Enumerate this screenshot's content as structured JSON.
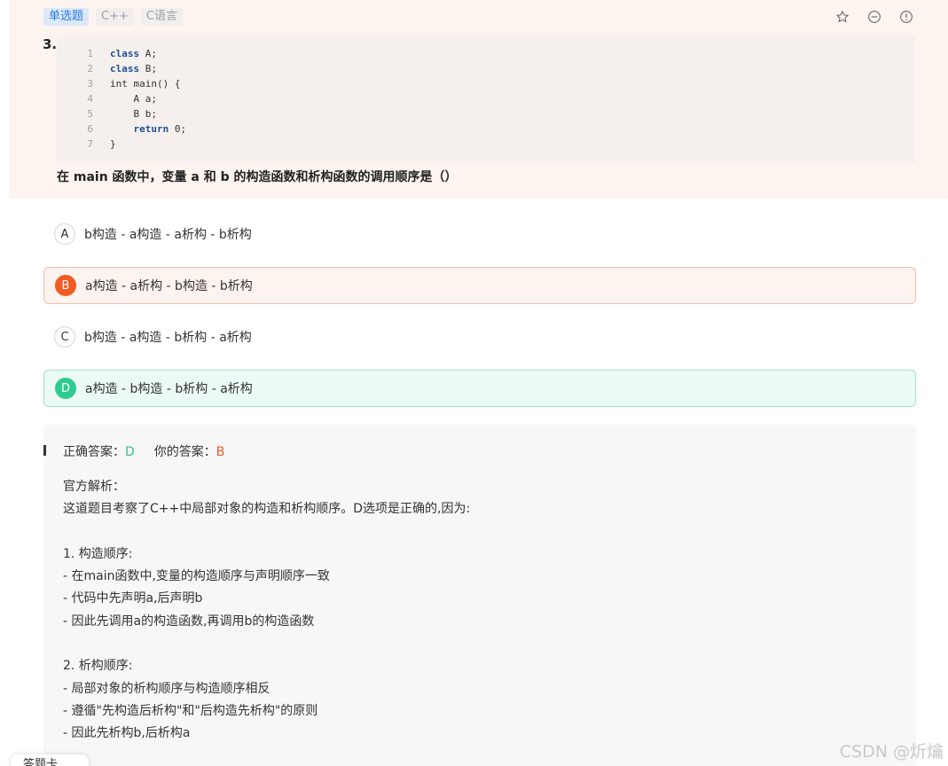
{
  "question": {
    "tags": [
      "单选题",
      "C++",
      "C语言"
    ],
    "number": "3.",
    "code": [
      {
        "n": "1",
        "kw": "class",
        "rest": " A;"
      },
      {
        "n": "2",
        "kw": "class",
        "rest": " B;"
      },
      {
        "n": "3",
        "kw": "",
        "rest": "int main() {"
      },
      {
        "n": "4",
        "kw": "",
        "rest": "    A a;"
      },
      {
        "n": "5",
        "kw": "",
        "rest": "    B b;"
      },
      {
        "n": "6",
        "kw": "return",
        "indent": "    ",
        "rest": " 0;"
      },
      {
        "n": "7",
        "kw": "",
        "rest": "}"
      }
    ],
    "text": "在 main 函数中，变量 a 和 b 的构造函数和析构函数的调用顺序是（）"
  },
  "tools": [
    "star-icon",
    "minus-circle-icon",
    "info-circle-icon"
  ],
  "options": [
    {
      "letter": "A",
      "text": "b构造 - a构造 - a析构 - b析构",
      "state": "normal"
    },
    {
      "letter": "B",
      "text": "a构造 - a析构 - b构造 - b析构",
      "state": "selected-wrong"
    },
    {
      "letter": "C",
      "text": "b构造 - a构造 - b析构 - a析构",
      "state": "normal"
    },
    {
      "letter": "D",
      "text": "a构造 - b构造 - b析构 - a析构",
      "state": "correct"
    }
  ],
  "answer": {
    "correct_label": "正确答案：",
    "correct_value": "D",
    "yours_label": "你的答案：",
    "yours_value": "B"
  },
  "analysis": "官方解析：\n这道题目考察了C++中局部对象的构造和析构顺序。D选项是正确的,因为:\n\n1. 构造顺序:\n- 在main函数中,变量的构造顺序与声明顺序一致\n- 代码中先声明a,后声明b\n- 因此先调用a的构造函数,再调用b的构造函数\n\n2. 析构顺序:\n- 局部对象的析构顺序与构造顺序相反\n- 遵循\"先构造后析构\"和\"后构造先析构\"的原则\n- 因此先析构b,后析构a",
  "watermark": "CSDN @炘爚",
  "bottom_tab": "答题卡",
  "colors": {
    "primary": "#2a7ae2",
    "wrong": "#f25a23",
    "correct": "#2fcc91",
    "header_bg": "#fdf3ef"
  }
}
